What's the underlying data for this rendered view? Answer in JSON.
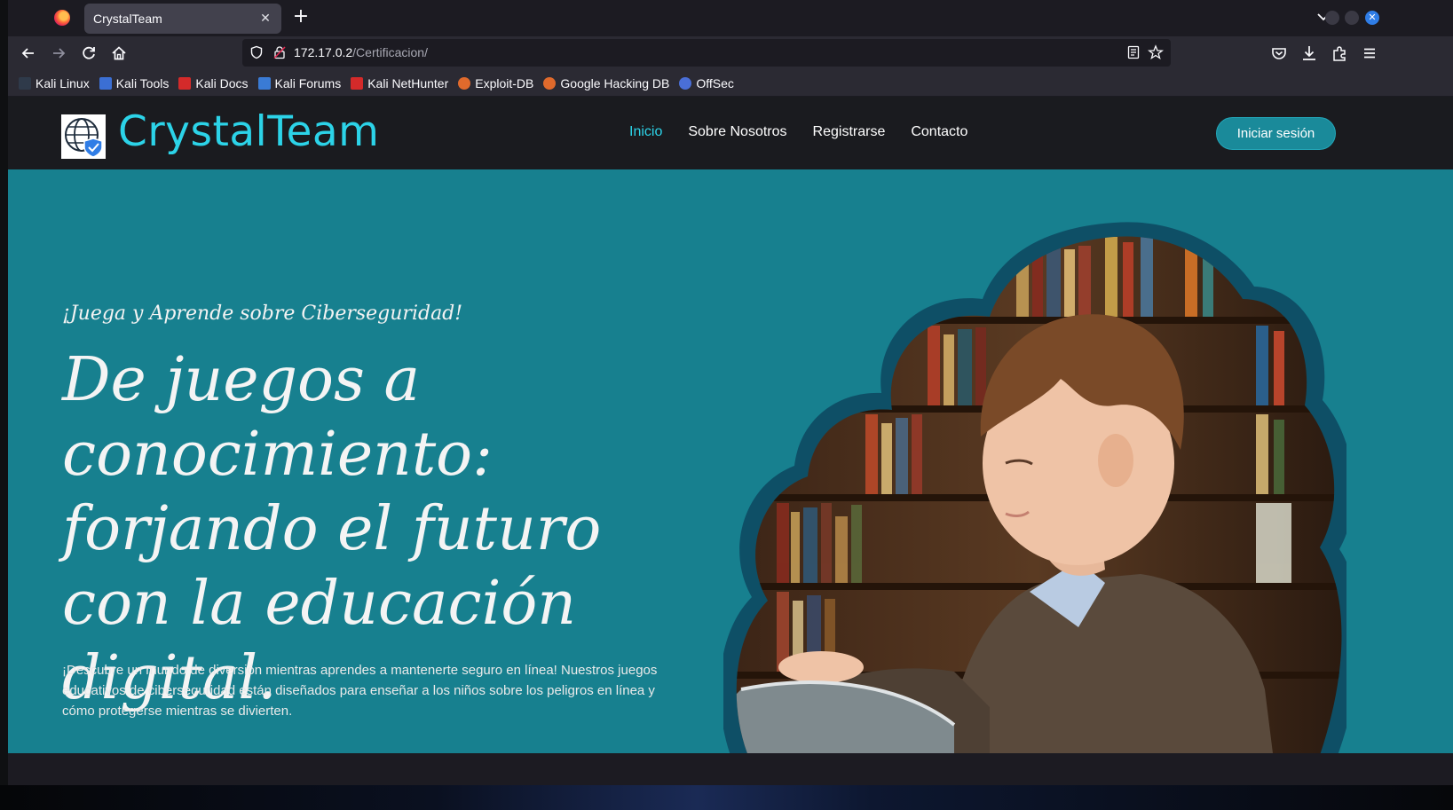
{
  "browser": {
    "tab_title": "CrystalTeam",
    "tab_close": "✕",
    "new_tab": "+",
    "url_host": "172.17.0.2",
    "url_path": "/Certificacion/",
    "bookmarks": [
      {
        "label": "Kali Linux",
        "color": "#2f3a4a"
      },
      {
        "label": "Kali Tools",
        "color": "#3b6fd4"
      },
      {
        "label": "Kali Docs",
        "color": "#d42a2a"
      },
      {
        "label": "Kali Forums",
        "color": "#3a7bd5"
      },
      {
        "label": "Kali NetHunter",
        "color": "#d42a2a"
      },
      {
        "label": "Exploit-DB",
        "color": "#e06a2c"
      },
      {
        "label": "Google Hacking DB",
        "color": "#e06a2c"
      },
      {
        "label": "OffSec",
        "color": "#4a6fd8"
      }
    ]
  },
  "site": {
    "brand": "CrystalTeam",
    "nav": [
      "Inicio",
      "Sobre Nosotros",
      "Registrarse",
      "Contacto"
    ],
    "login": "Iniciar sesión"
  },
  "hero": {
    "eyebrow": "¡Juega y Aprende sobre Ciberseguridad!",
    "headline": "De juegos a conocimiento: forjando el futuro con la educación digital.",
    "description": "¡Descubre un mundo de diversión mientras aprendes a mantenerte seguro en línea! Nuestros juegos educativos de ciberseguridad están diseñados para enseñar a los niños sobre los peligros en línea y cómo protegerse mientras se divierten."
  },
  "colors": {
    "accent": "#2cd3e8",
    "hero_bg": "#17808f",
    "header_bg": "#1a1b1f"
  }
}
